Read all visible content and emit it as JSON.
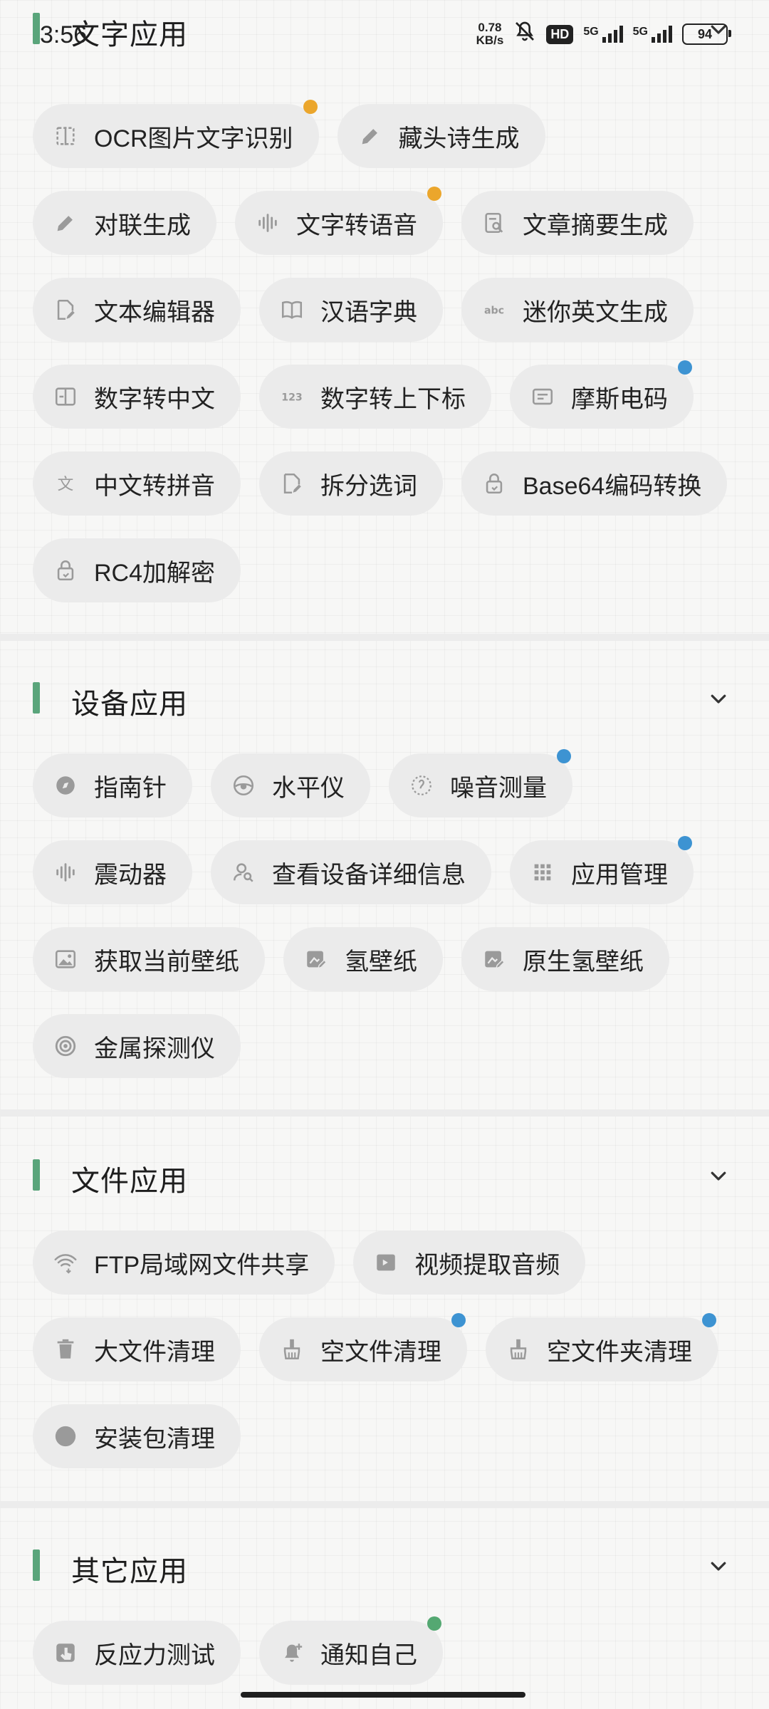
{
  "status_bar": {
    "time": "3:56",
    "net_speed_value": "0.78",
    "net_speed_unit": "KB/s",
    "hd": "HD",
    "sim1": "5G",
    "sim2": "5G",
    "battery": "94"
  },
  "sections": [
    {
      "title": "文字应用",
      "items": [
        {
          "label": "OCR图片文字识别",
          "icon": "ocr-scan-icon",
          "dot": "orange"
        },
        {
          "label": "藏头诗生成",
          "icon": "pencil-icon"
        },
        {
          "label": "对联生成",
          "icon": "pencil-icon"
        },
        {
          "label": "文字转语音",
          "icon": "waveform-icon",
          "dot": "orange"
        },
        {
          "label": "文章摘要生成",
          "icon": "document-search-icon"
        },
        {
          "label": "文本编辑器",
          "icon": "document-edit-icon"
        },
        {
          "label": "汉语字典",
          "icon": "book-icon"
        },
        {
          "label": "迷你英文生成",
          "icon": "abc-icon"
        },
        {
          "label": "数字转中文",
          "icon": "number-box-icon"
        },
        {
          "label": "数字转上下标",
          "icon": "123-icon"
        },
        {
          "label": "摩斯电码",
          "icon": "card-icon",
          "dot": "blue"
        },
        {
          "label": "中文转拼音",
          "icon": "translate-icon"
        },
        {
          "label": "拆分选词",
          "icon": "document-edit-icon"
        },
        {
          "label": "Base64编码转换",
          "icon": "lock-icon"
        },
        {
          "label": "RC4加解密",
          "icon": "lock-icon"
        }
      ]
    },
    {
      "title": "设备应用",
      "items": [
        {
          "label": "指南针",
          "icon": "compass-icon"
        },
        {
          "label": "水平仪",
          "icon": "level-icon"
        },
        {
          "label": "噪音测量",
          "icon": "noise-icon",
          "dot": "blue"
        },
        {
          "label": "震动器",
          "icon": "waveform-icon"
        },
        {
          "label": "查看设备详细信息",
          "icon": "user-search-icon"
        },
        {
          "label": "应用管理",
          "icon": "grid-icon",
          "dot": "blue"
        },
        {
          "label": "获取当前壁纸",
          "icon": "image-icon"
        },
        {
          "label": "氢壁纸",
          "icon": "image-edit-icon"
        },
        {
          "label": "原生氢壁纸",
          "icon": "image-edit-icon"
        },
        {
          "label": "金属探测仪",
          "icon": "radar-icon"
        }
      ]
    },
    {
      "title": "文件应用",
      "items": [
        {
          "label": "FTP局域网文件共享",
          "icon": "wifi-transfer-icon"
        },
        {
          "label": "视频提取音频",
          "icon": "video-audio-icon"
        },
        {
          "label": "大文件清理",
          "icon": "trash-icon"
        },
        {
          "label": "空文件清理",
          "icon": "broom-icon",
          "dot": "blue"
        },
        {
          "label": "空文件夹清理",
          "icon": "broom-icon",
          "dot": "blue"
        },
        {
          "label": "安装包清理",
          "icon": "circle-icon"
        }
      ]
    },
    {
      "title": "其它应用",
      "items": [
        {
          "label": "反应力测试",
          "icon": "tap-icon"
        },
        {
          "label": "通知自己",
          "icon": "bell-add-icon",
          "dot": "green"
        }
      ]
    }
  ],
  "colors": {
    "accent_bar": "#5aa57b",
    "dot_orange": "#eba62c",
    "dot_blue": "#3d93d2",
    "dot_green": "#54a872",
    "chip_bg": "#ebebeb"
  }
}
